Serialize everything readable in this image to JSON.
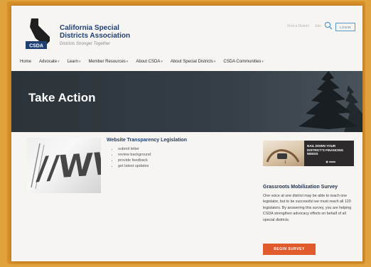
{
  "header": {
    "org_name": "California Special Districts Association",
    "tagline": "Districts Stronger Together",
    "logo_text": "CSDA",
    "top_links": [
      "Find a District",
      "Join"
    ],
    "login_label": "LOGIN"
  },
  "nav": {
    "items": [
      {
        "label": "Home",
        "has_menu": false
      },
      {
        "label": "Advocate",
        "has_menu": true
      },
      {
        "label": "Learn",
        "has_menu": true
      },
      {
        "label": "Member Resources",
        "has_menu": true
      },
      {
        "label": "About CSDA",
        "has_menu": true
      },
      {
        "label": "About Special Districts",
        "has_menu": true
      },
      {
        "label": "CSDA Communities",
        "has_menu": true
      }
    ]
  },
  "hero": {
    "title": "Take Action"
  },
  "legislation": {
    "image_text": "//WW",
    "title": "Website Transparency Legislation",
    "items": [
      "submit letter",
      "review background",
      "provide feedback",
      "get latest updates"
    ]
  },
  "ad": {
    "text": "NAIL DOWN YOUR DISTRICT'S FINANCING NEEDS"
  },
  "survey": {
    "title": "Grassroots Mobilization Survey",
    "body": "One voice at one district may be able to reach one legislator, but to be successful we must reach all 120 legislators. By answering this survey, you are helping CSDA strengthen advocacy efforts on behalf of all special districts.",
    "button_label": "BEGIN SURVEY"
  },
  "colors": {
    "frame": "#e0a23c",
    "brand_blue": "#1f3f73",
    "hero_dark": "#2c343a",
    "cta_orange": "#e15a2c",
    "login_border": "#5a98c8"
  },
  "icons": [
    "california-logo-icon",
    "search-icon",
    "caret-down-icon",
    "pine-tree-icon",
    "bullet-icon"
  ]
}
